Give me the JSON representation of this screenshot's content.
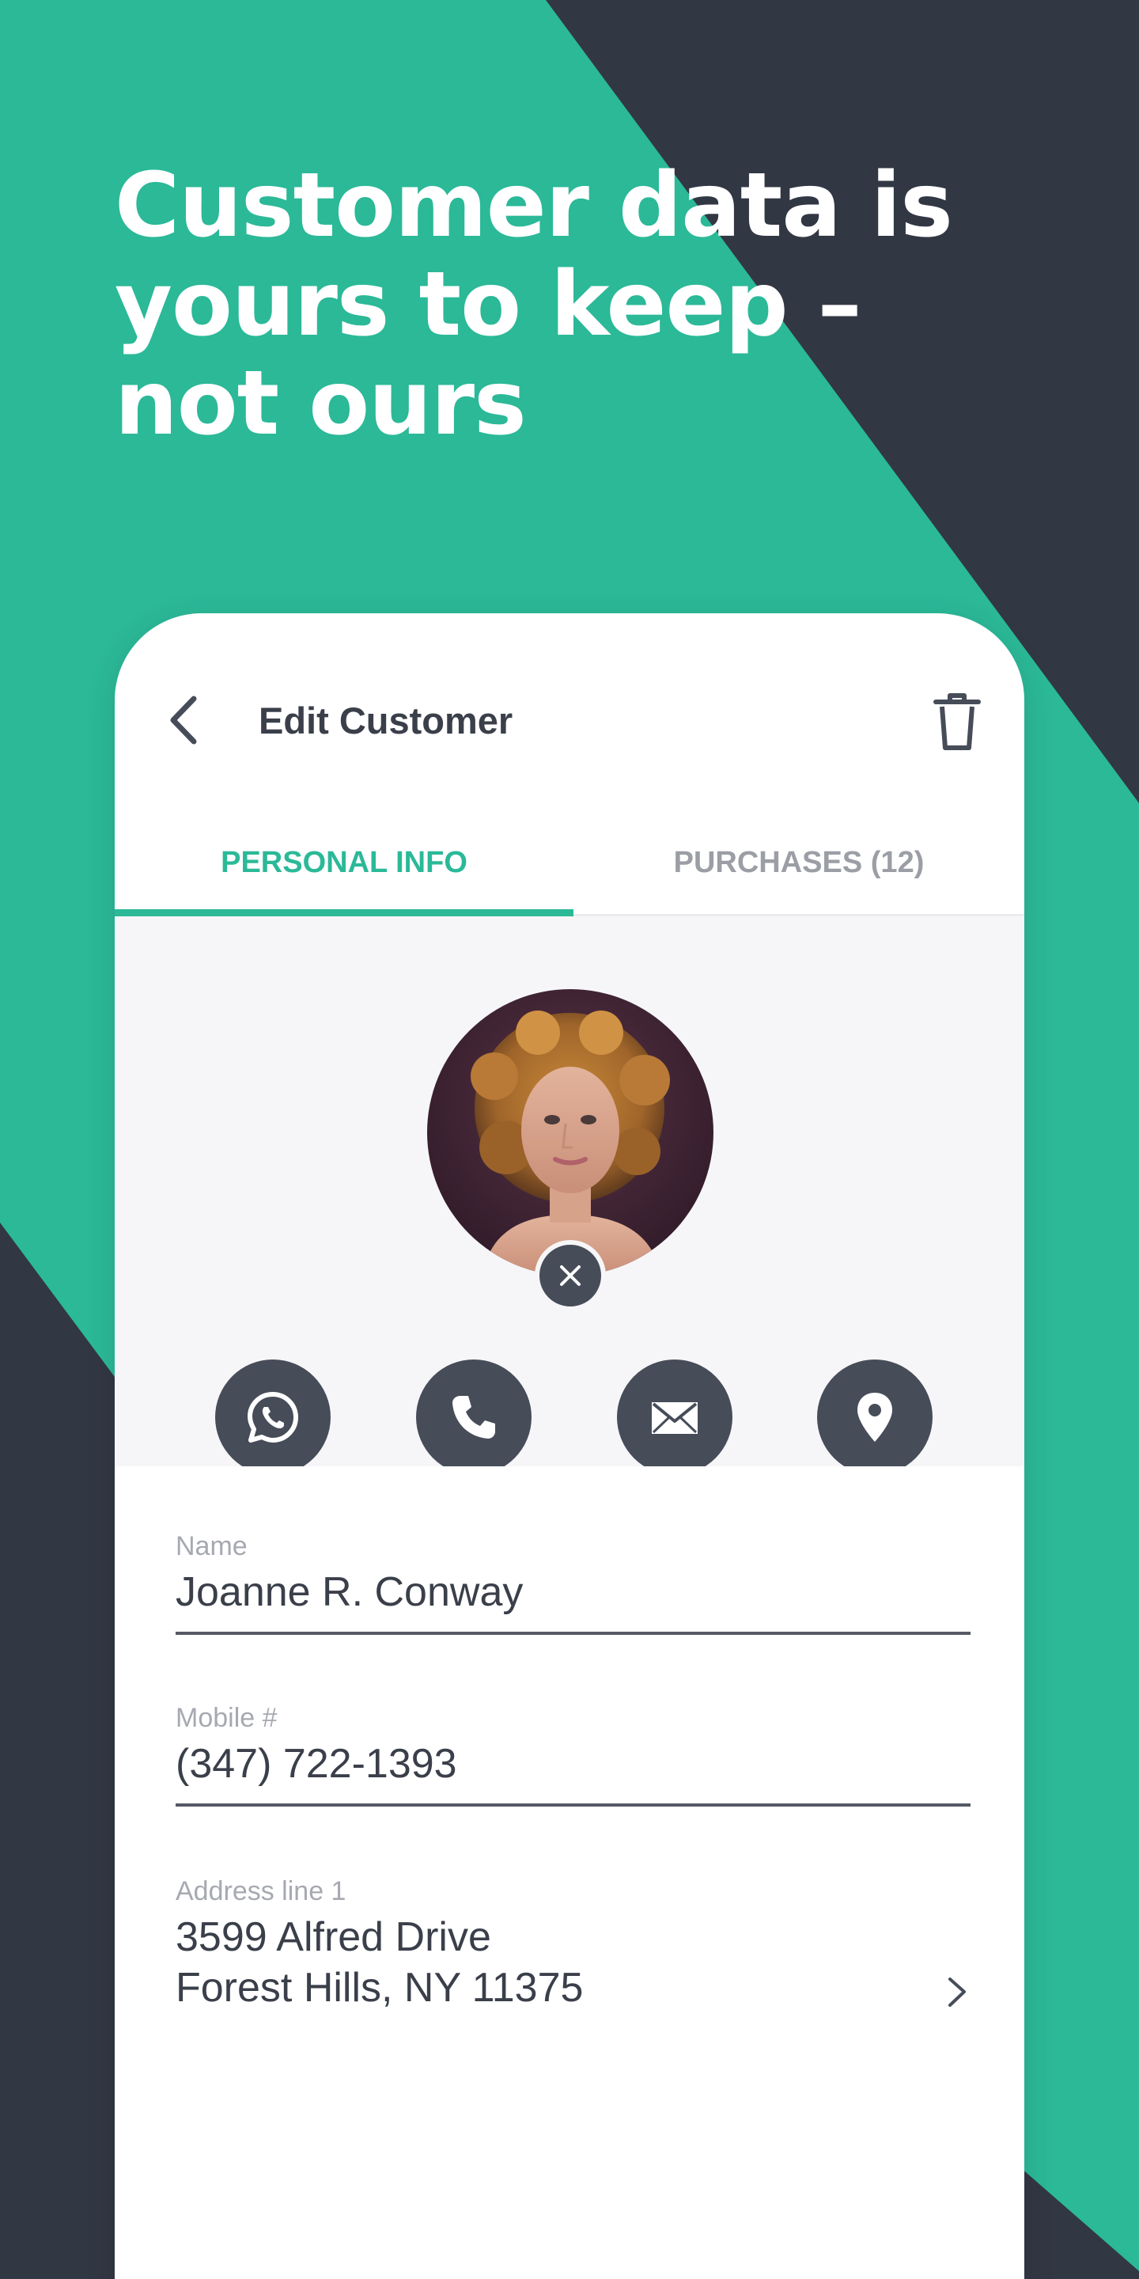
{
  "headline": "Customer data is yours to keep – not ours",
  "colors": {
    "accent": "#2bb998",
    "dark": "#323744",
    "icon_circle": "#474c59"
  },
  "appbar": {
    "back_icon": "chevron-left-icon",
    "title": "Edit Customer",
    "delete_icon": "trash-icon"
  },
  "tabs": [
    {
      "label": "PERSONAL INFO",
      "active": true
    },
    {
      "label": "PURCHASES (12)",
      "active": false
    }
  ],
  "profile": {
    "avatar_icon": "customer-photo",
    "remove_icon": "close-icon",
    "actions": [
      {
        "icon": "whatsapp-icon"
      },
      {
        "icon": "phone-icon"
      },
      {
        "icon": "email-icon"
      },
      {
        "icon": "location-pin-icon"
      }
    ]
  },
  "form": {
    "name": {
      "label": "Name",
      "value": "Joanne R. Conway"
    },
    "mobile": {
      "label": "Mobile #",
      "value": "(347) 722-1393"
    },
    "address": {
      "label": "Address line 1",
      "line1": "3599 Alfred Drive",
      "line2": "Forest Hills, NY 11375",
      "chevron_icon": "chevron-right-icon"
    }
  }
}
